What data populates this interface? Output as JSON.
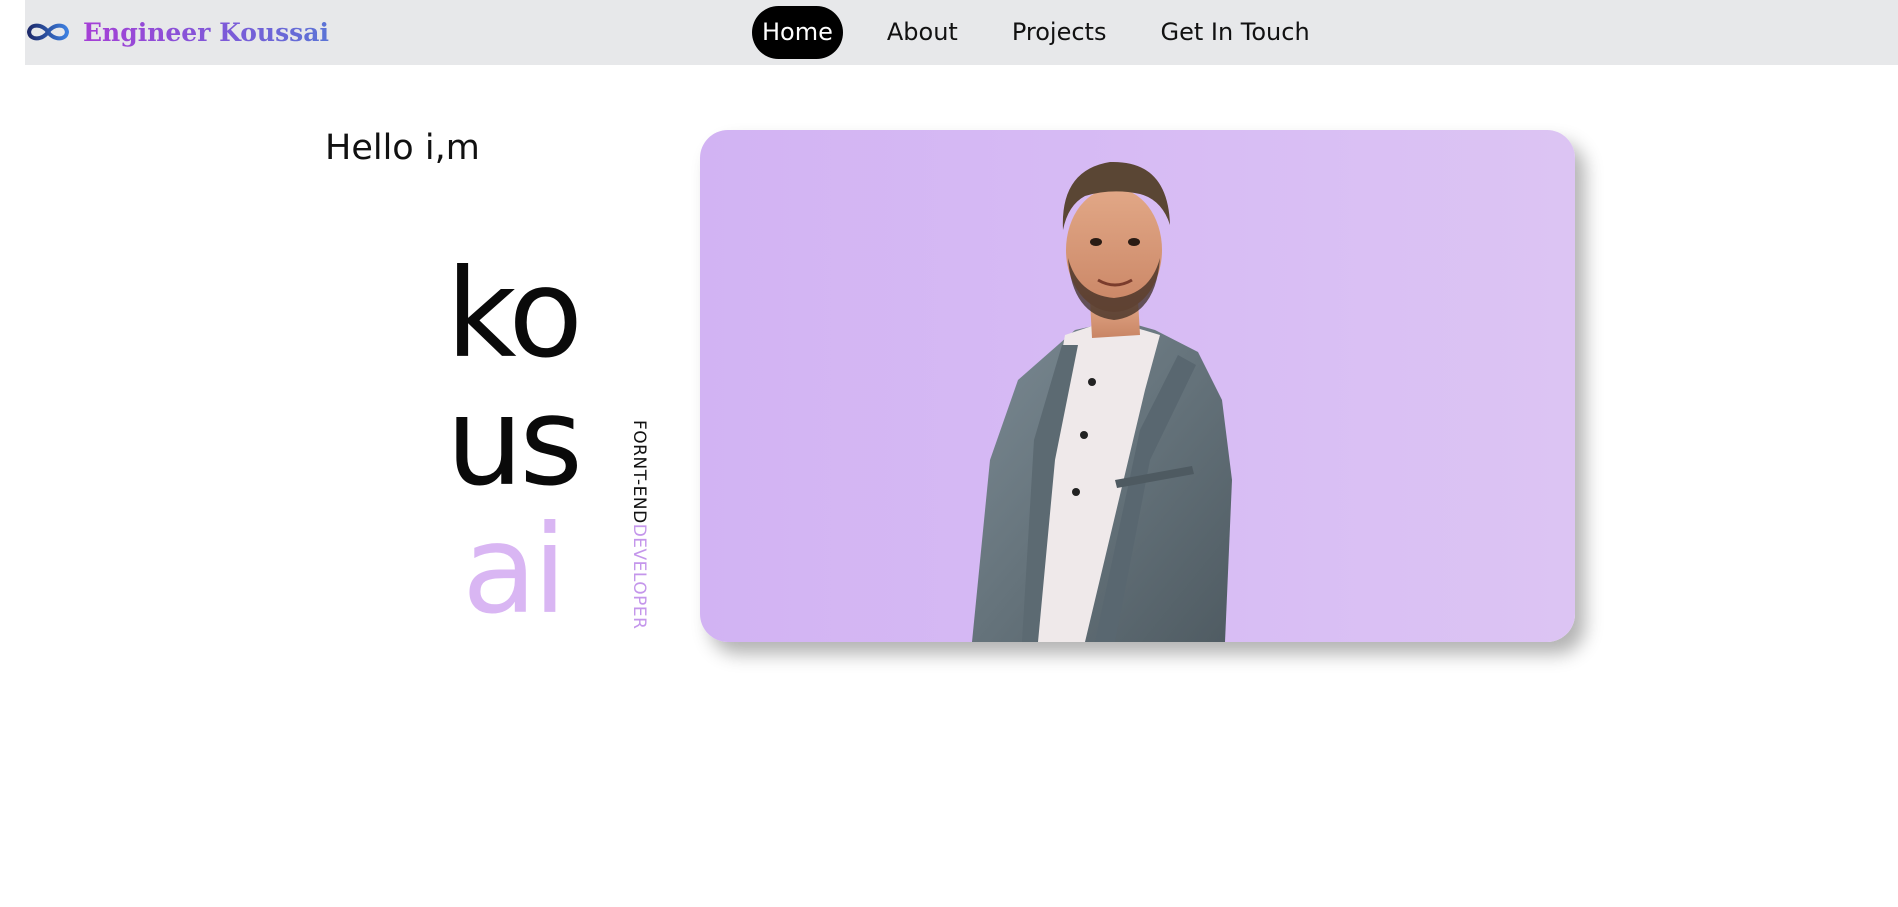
{
  "brand": {
    "logo_icon": "infinity-icon",
    "name": "Engineer Koussai",
    "gradient": [
      "#a63fd6",
      "#5b74d6"
    ]
  },
  "nav": {
    "items": [
      {
        "label": "Home",
        "active": true
      },
      {
        "label": "About",
        "active": false
      },
      {
        "label": "Projects",
        "active": false
      },
      {
        "label": "Get In Touch",
        "active": false
      }
    ]
  },
  "hero": {
    "greeting": "Hello i,m",
    "name_parts": [
      "ko",
      "us",
      "ai"
    ],
    "role_part1": "FORNT-END",
    "role_part2": "DEVELOPER",
    "accent_color": "#d9b6f3",
    "photo": {
      "subject": "portrait-photo",
      "background": "#d4b6f3"
    }
  }
}
